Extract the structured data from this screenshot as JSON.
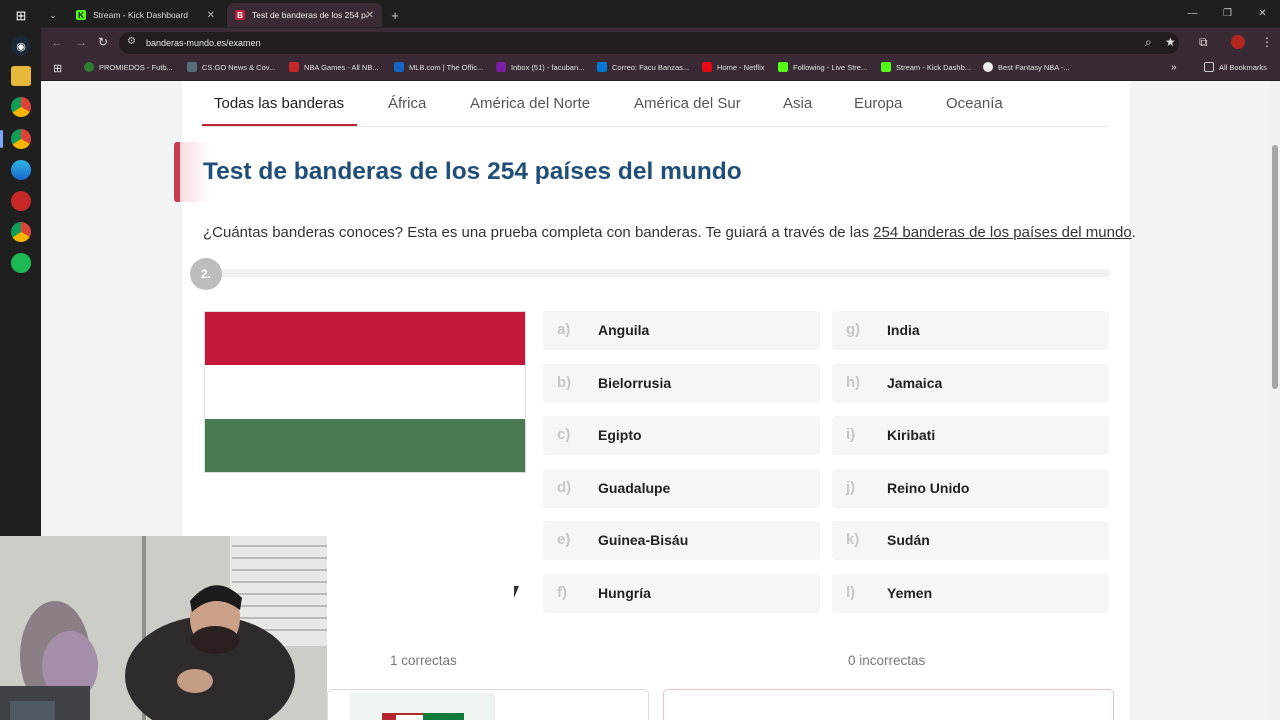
{
  "browser": {
    "tabs": [
      {
        "label": "Stream - Kick Dashboard",
        "favicon": "K",
        "active": false
      },
      {
        "label": "Test de banderas de los 254 pa",
        "favicon": "B",
        "active": true
      }
    ],
    "new_tab_symbol": "+",
    "url": "banderas-mundo.es/examen",
    "bookmarks": [
      "PROMIEDOS - Futb...",
      "CS:GO News & Cov...",
      "NBA Games - All NB...",
      "MLB.com | The Offic...",
      "Inbox (51) - facuban...",
      "Correo: Facu Banzas...",
      "Home - Netflix",
      "Following - Live Stre...",
      "Stream - Kick Dashb...",
      "Best Fantasy NBA -..."
    ],
    "all_bookmarks": "All Bookmarks",
    "colors": {
      "tab_active": "#3a2a35"
    }
  },
  "site": {
    "categories": [
      "Todas las banderas",
      "África",
      "América del Norte",
      "América del Sur",
      "Asia",
      "Europa",
      "Oceanía"
    ],
    "title": "Test de banderas de los 254 países del mundo",
    "intro_text": "¿Cuántas banderas conoces? Esta es una prueba completa con banderas. Te guiará a través de las ",
    "intro_link": "254 banderas de los países del mundo",
    "intro_end": ".",
    "question_number": "2.",
    "flag_colors": [
      "#c3173c",
      "#ffffff",
      "#497a53"
    ],
    "options": [
      {
        "letter": "a)",
        "name": "Anguila"
      },
      {
        "letter": "b)",
        "name": "Bielorrusia"
      },
      {
        "letter": "c)",
        "name": "Egipto"
      },
      {
        "letter": "d)",
        "name": "Guadalupe"
      },
      {
        "letter": "e)",
        "name": "Guinea-Bisáu"
      },
      {
        "letter": "f)",
        "name": "Hungría"
      },
      {
        "letter": "g)",
        "name": "India"
      },
      {
        "letter": "h)",
        "name": "Jamaica"
      },
      {
        "letter": "i)",
        "name": "Kiribati"
      },
      {
        "letter": "j)",
        "name": "Reino Unido"
      },
      {
        "letter": "k)",
        "name": "Sudán"
      },
      {
        "letter": "l)",
        "name": "Yemen"
      }
    ],
    "correct_label": "1 correctas",
    "incorrect_label": "0 incorrectas",
    "accent_color": "#c0213a",
    "title_color": "#1f4e79"
  }
}
